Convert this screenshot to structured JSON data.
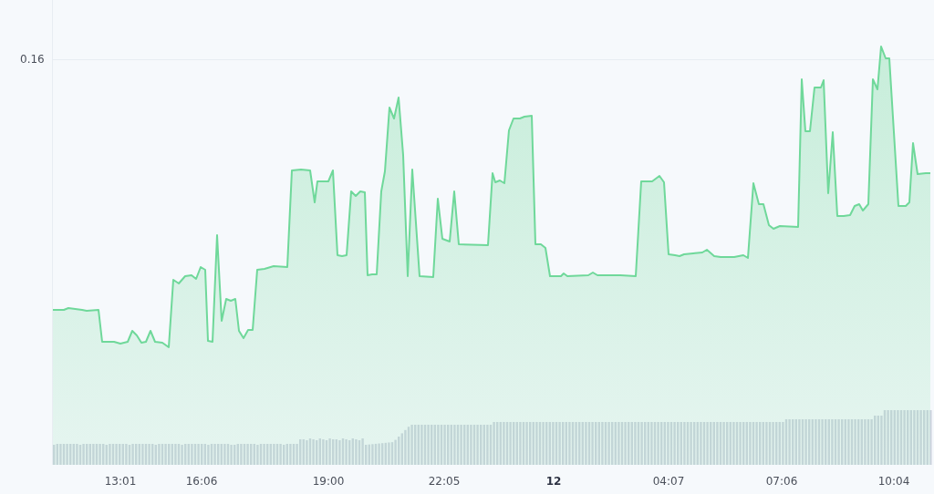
{
  "y_axis": {
    "ticks": [
      "0.16"
    ]
  },
  "x_axis": {
    "labels": [
      {
        "text": "13:01",
        "kind": "time"
      },
      {
        "text": "16:06",
        "kind": "time"
      },
      {
        "text": "19:00",
        "kind": "time"
      },
      {
        "text": "22:05",
        "kind": "time"
      },
      {
        "text": "12",
        "kind": "date"
      },
      {
        "text": "04:07",
        "kind": "time"
      },
      {
        "text": "07:06",
        "kind": "time"
      },
      {
        "text": "10:04",
        "kind": "time"
      }
    ]
  }
}
